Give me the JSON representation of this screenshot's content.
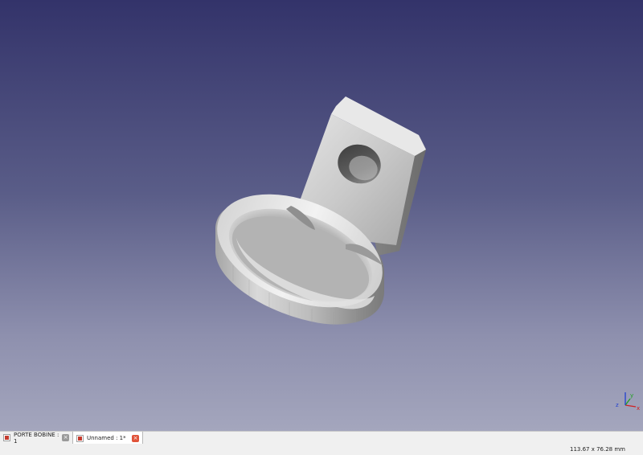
{
  "tabs": [
    {
      "label": "PORTE BOBINE : 1",
      "active": false
    },
    {
      "label": "Unnamed : 1*",
      "active": true
    }
  ],
  "close_glyph": "×",
  "status": {
    "dimensions": "113.67 x 76.28 mm"
  },
  "axis": {
    "x_label": "x",
    "y_label": "y",
    "z_label": "z",
    "x_color": "#d02020",
    "y_color": "#20a020",
    "z_color": "#2040d0"
  },
  "icons": {
    "document": "freecad-document-icon",
    "close": "close-icon"
  }
}
